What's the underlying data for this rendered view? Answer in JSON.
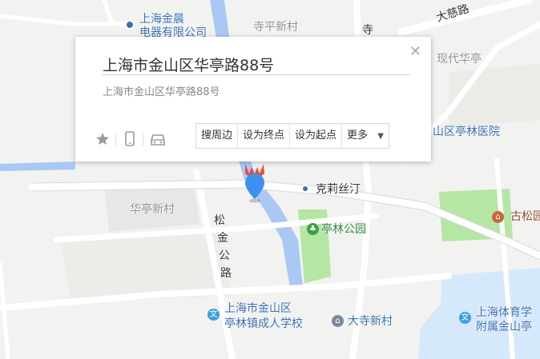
{
  "map": {
    "labels": {
      "hunlun": "上海金晨",
      "hunlun2": "电器有限公司",
      "siping": "寺平新村",
      "si": "寺",
      "daci": "大慈路",
      "xiandai": "现代华亭",
      "hospital": "山区亭林医院",
      "kelisi": "克莉丝汀",
      "huating": "华亭新村",
      "tinglin_park": "亭林公园",
      "gusong": "古松园",
      "songjin_1": "松",
      "songjin_2": "金",
      "songjin_3": "公",
      "songjin_4": "路",
      "school1": "上海市金山区",
      "school2": "亭林镇成人学校",
      "dasi": "大寺新村",
      "sports1": "上海体育学",
      "sports2": "附属金山亭"
    },
    "colors": {
      "water": "#a9c8f5",
      "park": "#b5e6a4",
      "road": "#ffffff",
      "marker": "#3f8ff0"
    }
  },
  "popup": {
    "title": "上海市金山区华亭路88号",
    "address": "上海市金山区华亭路88号",
    "close_icon": "close-icon",
    "icons": [
      "star-icon",
      "phone-icon",
      "car-icon"
    ],
    "buttons": {
      "nearby": "搜周边",
      "set_end": "设为终点",
      "set_start": "设为起点",
      "more": "更多"
    }
  }
}
